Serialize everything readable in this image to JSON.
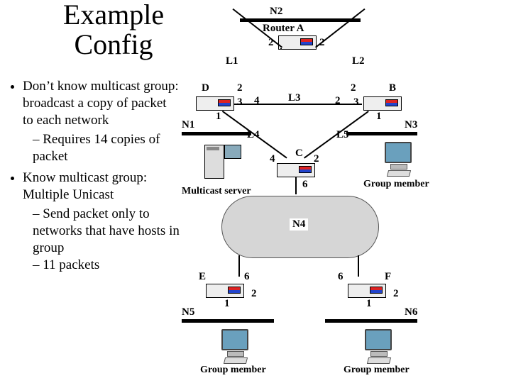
{
  "title": "Example Config",
  "bullets": {
    "b1": "Don’t know multicast group: broadcast a copy of packet to each network",
    "b1a": "Requires 14 copies of packet",
    "b2": "Know multicast group: Multiple Unicast",
    "b2a": "Send packet only to networks that have hosts in group",
    "b2b": "11 packets"
  },
  "labels": {
    "N1": "N1",
    "N2": "N2",
    "N3": "N3",
    "N4": "N4",
    "N5": "N5",
    "N6": "N6",
    "L1": "L1",
    "L2": "L2",
    "L3": "L3",
    "L4": "L4",
    "L5": "L5",
    "RouterA": "Router A",
    "D": "D",
    "B": "B",
    "C": "C",
    "E": "E",
    "F": "F",
    "MulticastServer": "Multicast server",
    "GroupMember": "Group member"
  },
  "ports": {
    "RA_left": "2",
    "RA_right": "2",
    "D_top": "2",
    "D_right": "3",
    "D_bot": "1",
    "B_top": "2",
    "B_left": "3",
    "B_bot": "1",
    "L3_left": "4",
    "L3_right": "2",
    "C_left": "4",
    "C_right": "2",
    "C_bot": "6",
    "E_right": "6",
    "E_bot": "1",
    "E_far": "2",
    "F_left": "6",
    "F_bot": "1",
    "F_far": "2"
  }
}
